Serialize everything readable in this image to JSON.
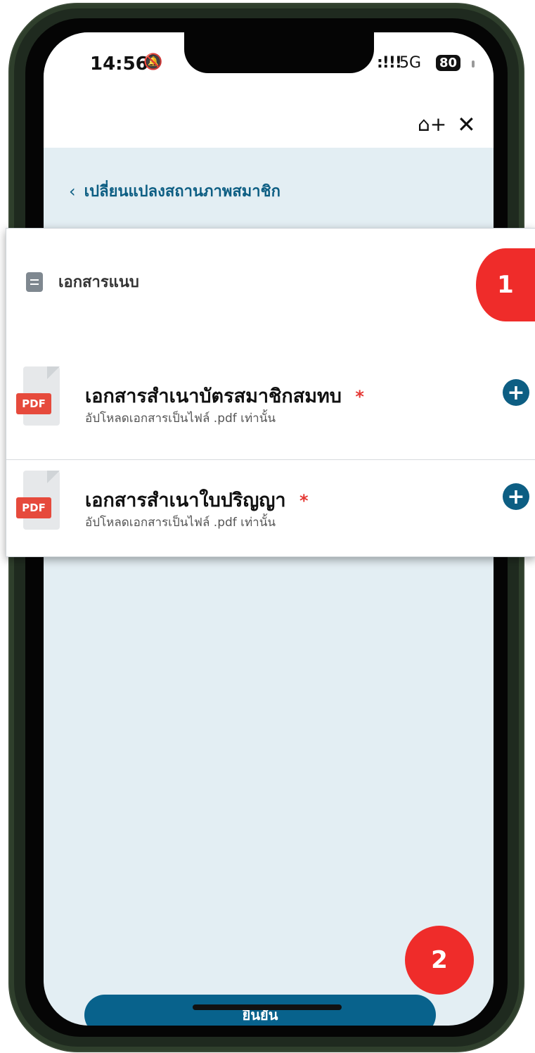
{
  "status_bar": {
    "time": "14:56",
    "network": "5G",
    "battery": "80"
  },
  "nav": {
    "back_label": "เปลี่ยนแปลงสถานภาพสมาชิก"
  },
  "section": {
    "title": "เอกสารแนบ",
    "callout_number": "1"
  },
  "documents": [
    {
      "title": "เอกสารสำเนาบัตรสมาชิกสมทบ",
      "required_marker": "*",
      "description": "อัปโหลดเอกสารเป็นไฟล์ .pdf เท่านั้น",
      "file_badge": "PDF"
    },
    {
      "title": "เอกสารสำเนาใบปริญญา",
      "required_marker": "*",
      "description": "อัปโหลดเอกสารเป็นไฟล์ .pdf เท่านั้น",
      "file_badge": "PDF"
    }
  ],
  "footer": {
    "confirm_label": "ยืนยัน",
    "callout_number": "2"
  },
  "colors": {
    "accent": "#0d5e83",
    "badge": "#ef2c2a",
    "screen_bg": "#e3eef3"
  },
  "icons": {
    "bell": "bell-off-icon",
    "signal": "signal-icon",
    "home": "home-add-icon",
    "close": "close-icon",
    "doc": "document-icon",
    "add": "plus-circle-icon"
  }
}
